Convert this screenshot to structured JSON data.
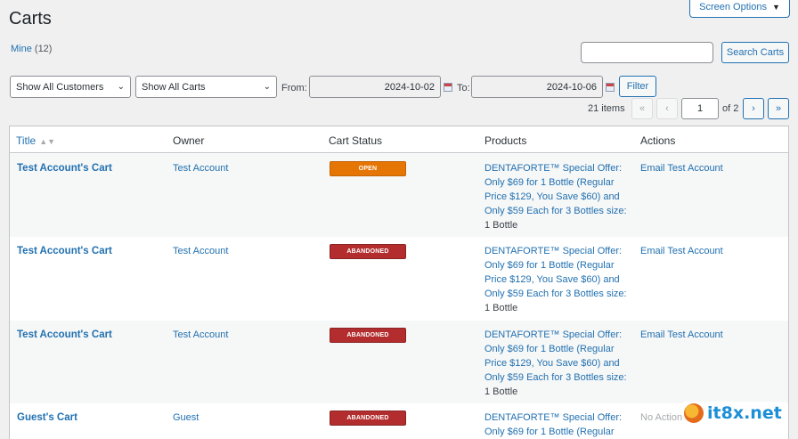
{
  "header": {
    "title": "Carts",
    "screen_options": "Screen Options"
  },
  "views": {
    "mine_label": "Mine",
    "mine_count": "(12)"
  },
  "search": {
    "button": "Search Carts",
    "value": ""
  },
  "filters": {
    "customers": "Show All Customers",
    "carts": "Show All Carts",
    "from_label": "From:",
    "from_value": "2024-10-02",
    "to_label": "To:",
    "to_value": "2024-10-06",
    "filter_button": "Filter"
  },
  "pagination": {
    "items": "21 items",
    "first": "«",
    "prev": "‹",
    "current": "1",
    "of": "of 2",
    "next": "›",
    "last": "»"
  },
  "table": {
    "columns": [
      "Title",
      "Owner",
      "Cart Status",
      "Products",
      "Actions"
    ],
    "rows": [
      {
        "title": "Test Account's Cart",
        "owner": "Test Account",
        "status": "OPEN",
        "product_lines": [
          "DENTAFORTE™ Special Offer:",
          "Only $69 for 1 Bottle (Regular",
          "Price $129, You Save $60) and",
          "Only $59 Each for 3 Bottles size:"
        ],
        "product_size": "1 Bottle",
        "action": "Email Test Account"
      },
      {
        "title": "Test Account's Cart",
        "owner": "Test Account",
        "status": "ABANDONED",
        "product_lines": [
          "DENTAFORTE™ Special Offer:",
          "Only $69 for 1 Bottle (Regular",
          "Price $129, You Save $60) and",
          "Only $59 Each for 3 Bottles size:"
        ],
        "product_size": "1 Bottle",
        "action": "Email Test Account"
      },
      {
        "title": "Test Account's Cart",
        "owner": "Test Account",
        "status": "ABANDONED",
        "product_lines": [
          "DENTAFORTE™ Special Offer:",
          "Only $69 for 1 Bottle (Regular",
          "Price $129, You Save $60) and",
          "Only $59 Each for 3 Bottles size:"
        ],
        "product_size": "1 Bottle",
        "action": "Email Test Account"
      },
      {
        "title": "Guest's Cart",
        "owner": "Guest",
        "status": "ABANDONED",
        "product_lines": [
          "DENTAFORTE™ Special Offer:",
          "Only $69 for 1 Bottle (Regular"
        ],
        "product_size": "",
        "action": "No Actions Av"
      }
    ]
  },
  "watermark": {
    "text": "it8x.net"
  },
  "colors": {
    "link": "#2271b1",
    "open": "#e57606",
    "abandoned": "#b32d2e"
  }
}
